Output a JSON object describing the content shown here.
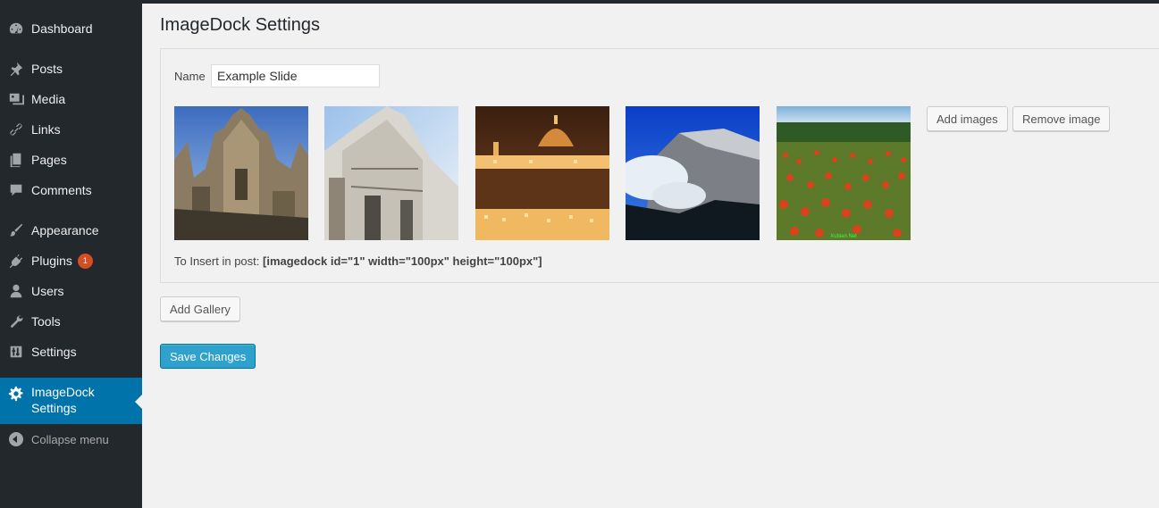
{
  "sidebar": {
    "items": [
      {
        "label": "Dashboard",
        "icon": "dashboard-icon"
      },
      {
        "label": "Posts",
        "icon": "pin-icon"
      },
      {
        "label": "Media",
        "icon": "media-icon"
      },
      {
        "label": "Links",
        "icon": "link-icon"
      },
      {
        "label": "Pages",
        "icon": "pages-icon"
      },
      {
        "label": "Comments",
        "icon": "comment-icon"
      },
      {
        "label": "Appearance",
        "icon": "brush-icon"
      },
      {
        "label": "Plugins",
        "icon": "plugin-icon",
        "badge": "1"
      },
      {
        "label": "Users",
        "icon": "user-icon"
      },
      {
        "label": "Tools",
        "icon": "wrench-icon"
      },
      {
        "label": "Settings",
        "icon": "settings-icon"
      },
      {
        "label": "ImageDock Settings",
        "label_line1": "ImageDock",
        "label_line2": "Settings",
        "icon": "gear-icon",
        "active": true
      }
    ],
    "collapse_label": "Collapse menu"
  },
  "page": {
    "title": "ImageDock Settings",
    "name_label": "Name",
    "name_value": "Example Slide",
    "add_images_label": "Add images",
    "remove_image_label": "Remove image",
    "shortcode_prefix": "To Insert in post:",
    "shortcode": "[imagedock id=\"1\" width=\"100px\" height=\"100px\"]",
    "add_gallery_label": "Add Gallery",
    "save_label": "Save Changes",
    "thumbnails": [
      {
        "name": "cathedral-photo"
      },
      {
        "name": "church-facade-photo"
      },
      {
        "name": "florence-night-photo"
      },
      {
        "name": "mountain-photo"
      },
      {
        "name": "poppy-field-photo",
        "watermark": "Xubian.Net"
      }
    ]
  },
  "colors": {
    "sidebar_bg": "#23282d",
    "active_bg": "#0073aa",
    "primary_button": "#2ea2cc",
    "badge": "#d54e21",
    "page_bg": "#f1f1f1"
  }
}
